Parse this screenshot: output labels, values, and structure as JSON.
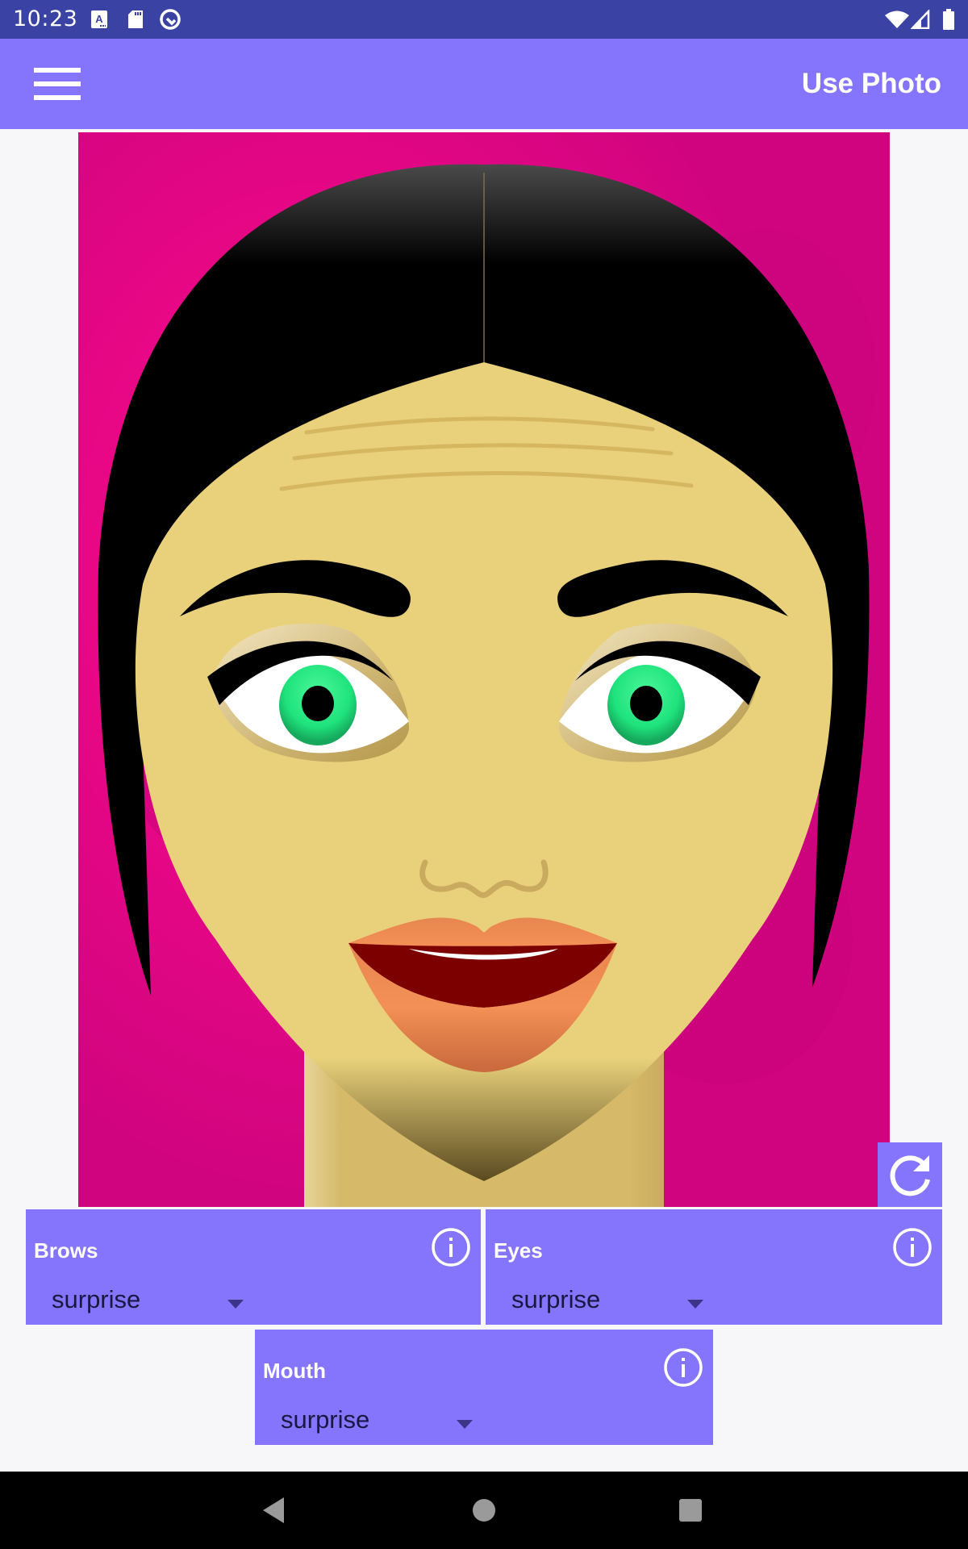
{
  "status_bar": {
    "time": "10:23",
    "left_icons": [
      "keyboard-a-icon",
      "sd-card-icon",
      "q-logo-icon"
    ],
    "right_icons": [
      "wifi-icon",
      "cell-signal-icon",
      "battery-icon"
    ]
  },
  "app_bar": {
    "menu_icon": "hamburger-menu-icon",
    "action_label": "Use Photo",
    "color": "#8574fc"
  },
  "canvas": {
    "description": "Cartoon face with black hair, yellow skin, green eyes, orange lips on pink background",
    "background_color": "#ff0a8c",
    "skin_color": "#e9d17b",
    "eye_color": "#2ee884",
    "lip_color": "#f08a50",
    "refresh_icon": "refresh-icon"
  },
  "controls": [
    {
      "label": "Brows",
      "selected": "surprise",
      "info_icon": "info-icon"
    },
    {
      "label": "Eyes",
      "selected": "surprise",
      "info_icon": "info-icon"
    },
    {
      "label": "Mouth",
      "selected": "surprise",
      "info_icon": "info-icon"
    }
  ],
  "nav_bar": {
    "buttons": [
      "back-icon",
      "home-icon",
      "recents-icon"
    ]
  }
}
